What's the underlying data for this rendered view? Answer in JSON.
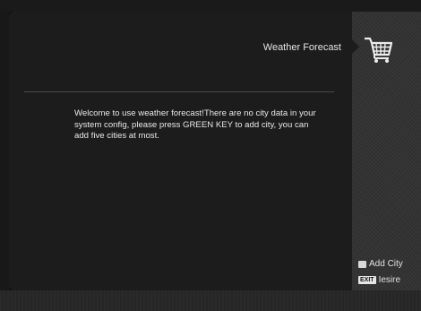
{
  "header": {
    "title": "Weather Forecast"
  },
  "main": {
    "message": "Welcome to use weather forecast!There are no city data in your system config, please press GREEN KEY to add city, you can add five cities at most."
  },
  "sidebar": {
    "icon": "shopping-cart-icon"
  },
  "legend": {
    "add_label": "Add City",
    "exit_key": "EXIT",
    "exit_label": "Iesire"
  },
  "colors": {
    "panel": "#1c1c1c",
    "sidebar": "#343434",
    "text": "#e6e6e6"
  }
}
